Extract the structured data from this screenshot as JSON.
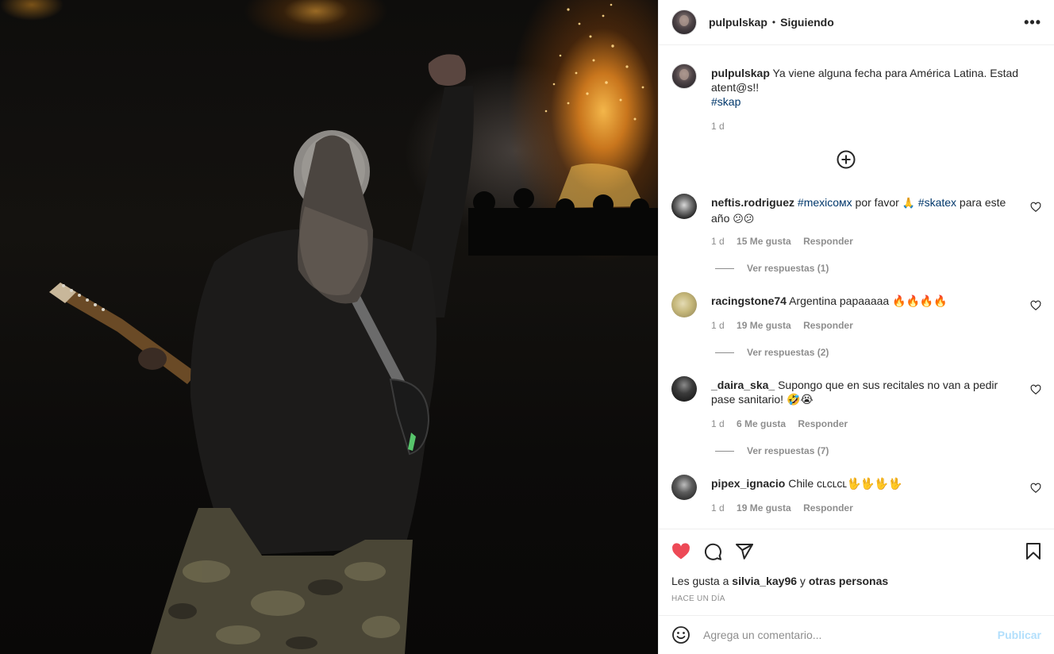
{
  "post": {
    "author": "pulpulskap",
    "separator": "•",
    "follow_status": "Siguiendo",
    "more_icon": "more-options-icon",
    "caption": "Ya viene alguna fecha para América Latina. Estad atent@s!!",
    "hashtag": "#skap",
    "caption_time": "1 d",
    "load_more_icon": "plus-circle-icon"
  },
  "comments": [
    {
      "user": "neftis.rodriguez",
      "parts": [
        "#mexicoмx",
        " por favor ",
        "🙏",
        " ",
        "#skatex",
        " para este año ",
        "😕😕"
      ],
      "time": "1 d",
      "likes": "15 Me gusta",
      "reply": "Responder",
      "view_replies": "Ver respuestas (1)"
    },
    {
      "user": "racingstone74",
      "text": "Argentina papaaaaa 🔥🔥🔥🔥",
      "time": "1 d",
      "likes": "19 Me gusta",
      "reply": "Responder",
      "view_replies": "Ver respuestas (2)"
    },
    {
      "user": "_daira_ska_",
      "text": "Supongo que en sus recitales no van a pedir pase sanitario! 🤣😭",
      "time": "1 d",
      "likes": "6 Me gusta",
      "reply": "Responder",
      "view_replies": "Ver respuestas (7)"
    },
    {
      "user": "pipex_ignacio",
      "text": "Chile ᴄʟᴄʟᴄʟ🖖🖖🖖🖖",
      "time": "1 d",
      "likes": "19 Me gusta",
      "reply": "Responder"
    }
  ],
  "actions": {
    "like_icon": "heart-filled-icon",
    "comment_icon": "comment-icon",
    "share_icon": "share-icon",
    "save_icon": "bookmark-icon",
    "liked_color": "#ed4956"
  },
  "likes_line": {
    "prefix": "Les gusta a ",
    "user": "silvia_kay96",
    "middle": " y ",
    "others": "otras personas"
  },
  "posted_ago": "Hace un día",
  "comment_box": {
    "emoji_icon": "emoji-smile-icon",
    "placeholder": "Agrega un comentario...",
    "publish_label": "Publicar",
    "publish_color": "#b2dffc"
  }
}
